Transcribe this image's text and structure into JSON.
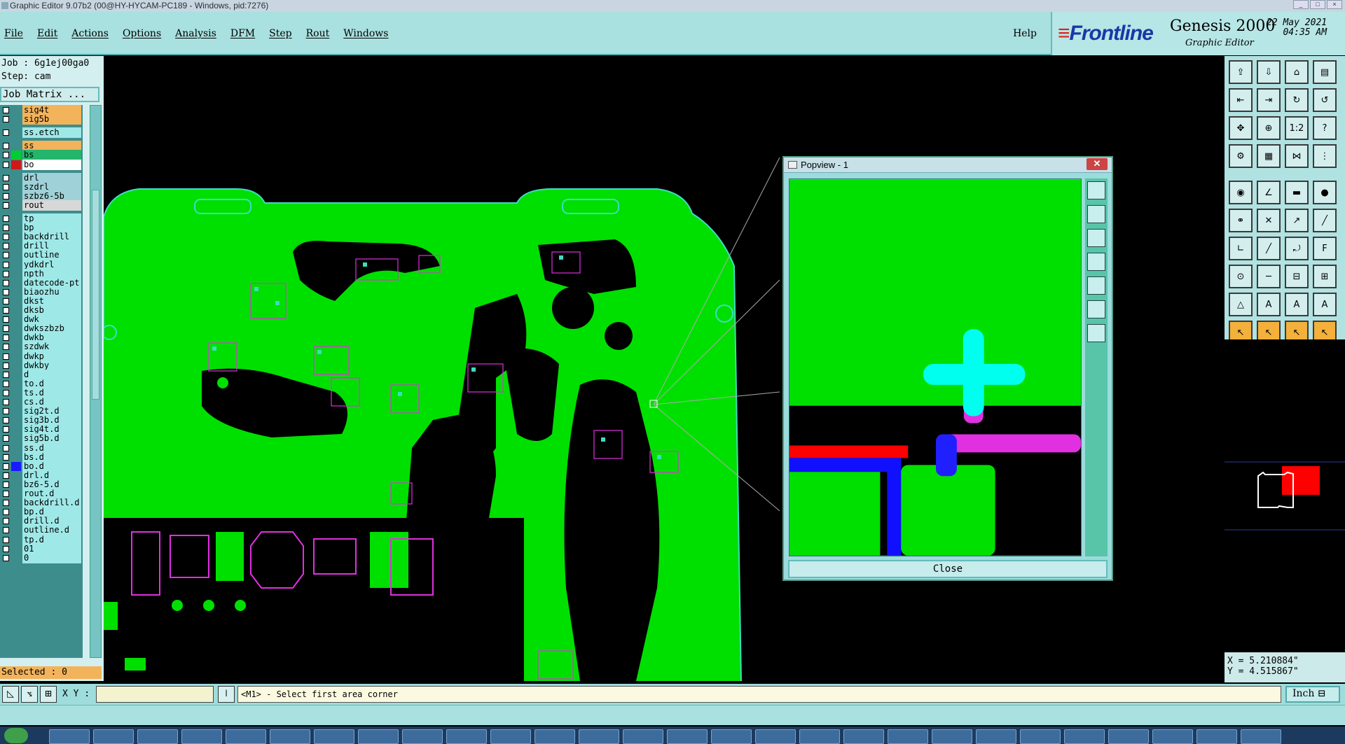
{
  "window": {
    "title": "Graphic Editor 9.07b2 (00@HY-HYCAM-PC189 - Windows, pid:7276)"
  },
  "menu": {
    "items": [
      "File",
      "Edit",
      "Actions",
      "Options",
      "Analysis",
      "DFM",
      "Step",
      "Rout",
      "Windows"
    ],
    "help": "Help"
  },
  "brand": {
    "logo_main": "Frontline",
    "product": "Genesis 2000",
    "subtitle": "Graphic Editor",
    "date": "22 May 2021",
    "time": "04:35 AM"
  },
  "job": {
    "job_label": "Job : 6g1ej00ga0",
    "step_label": "Step: cam",
    "matrix_button": "Job Matrix ..."
  },
  "layers": [
    {
      "name": "sig4t",
      "color": "#f3b35a",
      "swatch": ""
    },
    {
      "name": "sig5b",
      "color": "#f3b35a",
      "swatch": ""
    },
    {
      "name": "ss.etch",
      "color": "#9fe8e8",
      "swatch": ""
    },
    {
      "name": "ss",
      "color": "#f3b35a",
      "swatch": ""
    },
    {
      "name": "bs",
      "color": "#24b46c",
      "swatch": "#00cc33"
    },
    {
      "name": "bo",
      "color": "#ffffff",
      "swatch": "#d01818"
    },
    {
      "name": "drl",
      "color": "#9fd2d8",
      "swatch": ""
    },
    {
      "name": "szdrl",
      "color": "#9fd2d8",
      "swatch": ""
    },
    {
      "name": "szbz6-5b",
      "color": "#9fd2d8",
      "swatch": ""
    },
    {
      "name": "rout",
      "color": "#d8d8d8",
      "swatch": ""
    },
    {
      "name": "tp",
      "color": "#9fe8e8",
      "swatch": ""
    },
    {
      "name": "bp",
      "color": "#9fe8e8",
      "swatch": ""
    },
    {
      "name": "backdrill",
      "color": "#9fe8e8",
      "swatch": ""
    },
    {
      "name": "drill",
      "color": "#9fe8e8",
      "swatch": ""
    },
    {
      "name": "outline",
      "color": "#9fe8e8",
      "swatch": ""
    },
    {
      "name": "ydkdrl",
      "color": "#9fe8e8",
      "swatch": ""
    },
    {
      "name": "npth",
      "color": "#9fe8e8",
      "swatch": ""
    },
    {
      "name": "datecode-pt",
      "color": "#9fe8e8",
      "swatch": ""
    },
    {
      "name": "biaozhu",
      "color": "#9fe8e8",
      "swatch": ""
    },
    {
      "name": "dkst",
      "color": "#9fe8e8",
      "swatch": ""
    },
    {
      "name": "dksb",
      "color": "#9fe8e8",
      "swatch": ""
    },
    {
      "name": "dwk",
      "color": "#9fe8e8",
      "swatch": ""
    },
    {
      "name": "dwkszbzb",
      "color": "#9fe8e8",
      "swatch": ""
    },
    {
      "name": "dwkb",
      "color": "#9fe8e8",
      "swatch": ""
    },
    {
      "name": "szdwk",
      "color": "#9fe8e8",
      "swatch": ""
    },
    {
      "name": "dwkp",
      "color": "#9fe8e8",
      "swatch": ""
    },
    {
      "name": "dwkby",
      "color": "#9fe8e8",
      "swatch": ""
    },
    {
      "name": "d",
      "color": "#9fe8e8",
      "swatch": ""
    },
    {
      "name": "to.d",
      "color": "#9fe8e8",
      "swatch": ""
    },
    {
      "name": "ts.d",
      "color": "#9fe8e8",
      "swatch": ""
    },
    {
      "name": "cs.d",
      "color": "#9fe8e8",
      "swatch": ""
    },
    {
      "name": "sig2t.d",
      "color": "#9fe8e8",
      "swatch": ""
    },
    {
      "name": "sig3b.d",
      "color": "#9fe8e8",
      "swatch": ""
    },
    {
      "name": "sig4t.d",
      "color": "#9fe8e8",
      "swatch": ""
    },
    {
      "name": "sig5b.d",
      "color": "#9fe8e8",
      "swatch": ""
    },
    {
      "name": "ss.d",
      "color": "#9fe8e8",
      "swatch": ""
    },
    {
      "name": "bs.d",
      "color": "#9fe8e8",
      "swatch": ""
    },
    {
      "name": "bo.d",
      "color": "#9fe8e8",
      "swatch": "#1a1aff"
    },
    {
      "name": "drl.d",
      "color": "#9fe8e8",
      "swatch": ""
    },
    {
      "name": "bz6-5.d",
      "color": "#9fe8e8",
      "swatch": ""
    },
    {
      "name": "rout.d",
      "color": "#9fe8e8",
      "swatch": ""
    },
    {
      "name": "backdrill.d",
      "color": "#9fe8e8",
      "swatch": ""
    },
    {
      "name": "bp.d",
      "color": "#9fe8e8",
      "swatch": ""
    },
    {
      "name": "drill.d",
      "color": "#9fe8e8",
      "swatch": ""
    },
    {
      "name": "outline.d",
      "color": "#9fe8e8",
      "swatch": ""
    },
    {
      "name": "tp.d",
      "color": "#9fe8e8",
      "swatch": ""
    },
    {
      "name": "01",
      "color": "#9fe8e8",
      "swatch": ""
    },
    {
      "name": "0",
      "color": "#9fe8e8",
      "swatch": ""
    }
  ],
  "selected_label": "Selected : 0",
  "popview": {
    "title": "Popview - 1",
    "close_label": "Close"
  },
  "coordinates": {
    "x": "X = 5.210884\"",
    "y": "Y = 4.515867\""
  },
  "statusbar": {
    "xy_label": "X Y :",
    "xy_value": "",
    "prompt": "<M1> - Select first area corner",
    "unit": "Inch"
  },
  "colors": {
    "board": "#00e000",
    "copper_pad": "#00f000",
    "cut": "#000000",
    "outline": "#3fdbc0",
    "pads_magenta": "#e030e0",
    "cross": "#00ffee",
    "red": "#ff0000",
    "blue": "#1010ff"
  }
}
